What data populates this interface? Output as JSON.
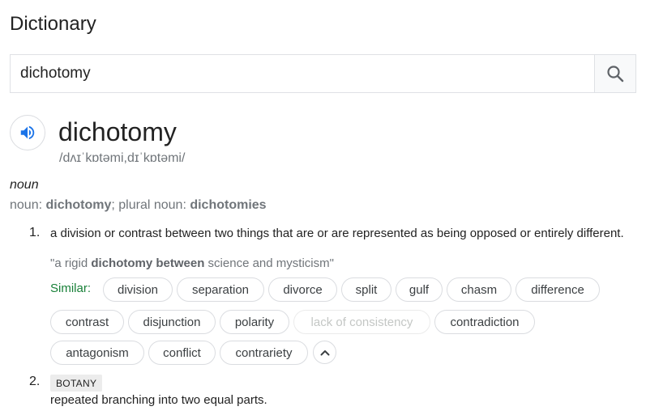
{
  "page": {
    "heading": "Dictionary"
  },
  "search": {
    "value": "dichotomy"
  },
  "entry": {
    "word": "dichotomy",
    "phonetic": "/dʌɪˈkɒtəmi,dɪˈkɒtəmi/",
    "part_of_speech": "noun",
    "forms": {
      "noun_label": "noun: ",
      "singular": "dichotomy",
      "plural_label": "; plural noun: ",
      "plural": "dichotomies"
    }
  },
  "senses": [
    {
      "number": "1.",
      "definition": "a division or contrast between two things that are or are represented as being opposed or entirely different.",
      "example": {
        "open": "\"a rigid ",
        "bold": "dichotomy between",
        "close": " science and mysticism\""
      },
      "similar_label": "Similar:",
      "similar": [
        "division",
        "separation",
        "divorce",
        "split",
        "gulf",
        "chasm",
        "difference",
        "contrast",
        "disjunction",
        "polarity",
        "lack of consistency",
        "contradiction",
        "antagonism",
        "conflict",
        "contrariety"
      ]
    },
    {
      "number": "2.",
      "domain": "BOTANY",
      "definition": "repeated branching into two equal parts."
    }
  ],
  "icons": {
    "search": "search-icon",
    "speaker": "speaker-icon",
    "collapse": "chevron-up-icon"
  },
  "colors": {
    "similar_label": "#188038",
    "speaker": "#1a73e8"
  }
}
